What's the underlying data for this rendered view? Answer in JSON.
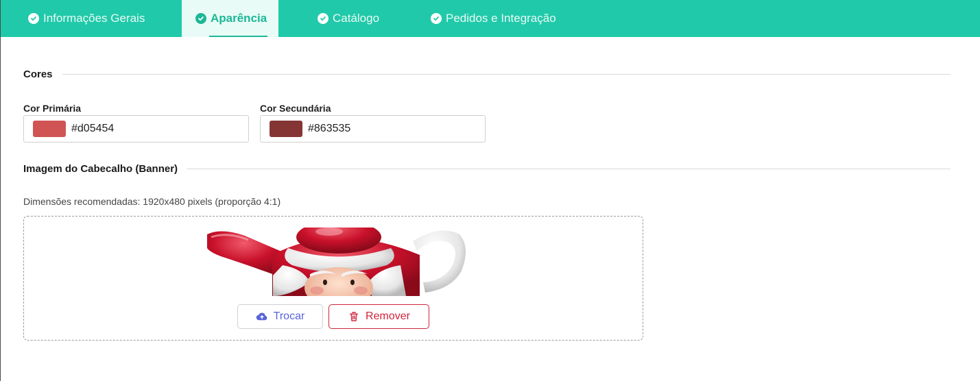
{
  "tabs": [
    {
      "label": "Informações Gerais",
      "active": false
    },
    {
      "label": "Aparência",
      "active": true
    },
    {
      "label": "Catálogo",
      "active": false
    },
    {
      "label": "Pedidos e Integração",
      "active": false
    }
  ],
  "colors_section": {
    "title": "Cores",
    "primary": {
      "label": "Cor Primária",
      "value": "#d05454"
    },
    "secondary": {
      "label": "Cor Secundária",
      "value": "#863535"
    }
  },
  "banner_section": {
    "title": "Imagem do Cabecalho (Banner)",
    "hint": "Dimensões recomendadas: 1920x480 pixels (proporção 4:1)",
    "replace_label": "Trocar",
    "remove_label": "Remover",
    "replace_icon": "cloud-upload-icon",
    "remove_icon": "trash-icon"
  },
  "theme": {
    "tab_bar": "#20c9a9",
    "tab_active_bg": "#e9fbf6",
    "tab_active_text": "#1bb897",
    "replace_color": "#5a63d9",
    "remove_color": "#d0243c"
  }
}
